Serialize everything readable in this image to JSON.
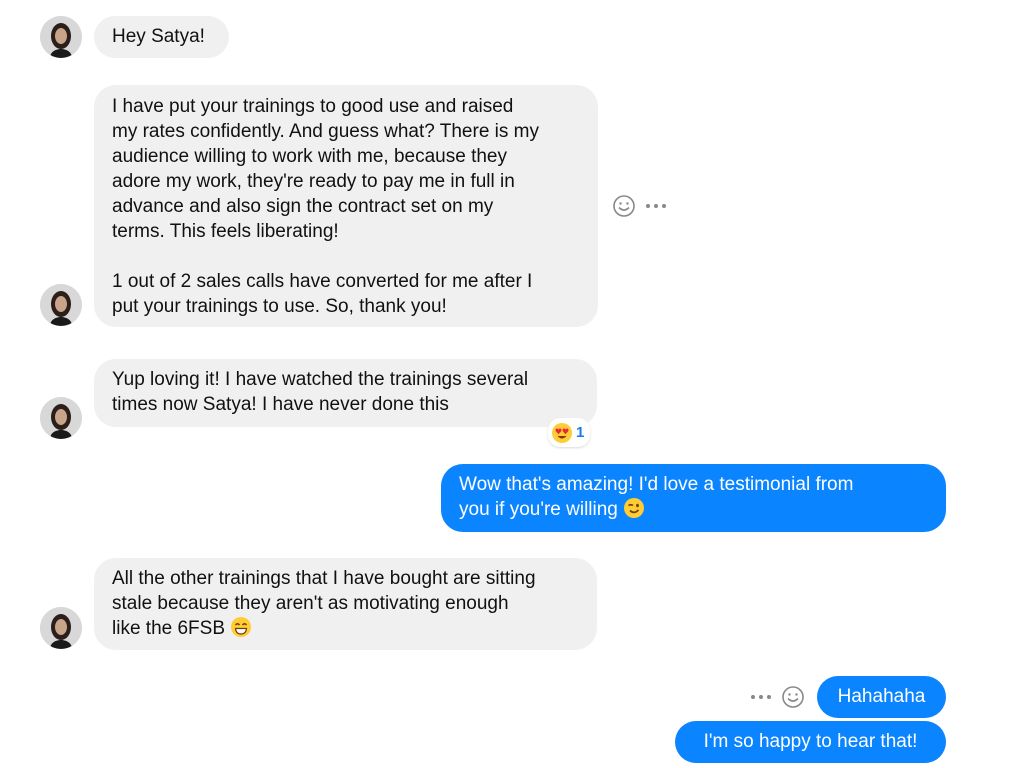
{
  "conversation": {
    "messages": [
      {
        "id": "m1",
        "from": "contact",
        "text": "Hey Satya!"
      },
      {
        "id": "m2",
        "from": "contact",
        "text": "I have put your trainings to good use and raised\nmy rates confidently. And guess what? There is my\naudience willing to work with me, because they\nadore my work, they're ready to pay me in full in\nadvance and also sign the contract set on my\nterms. This feels liberating!\n\n1 out of 2 sales calls have converted for me after I\nput your trainings to use. So, thank you!"
      },
      {
        "id": "m3",
        "from": "contact",
        "text": "Yup loving it! I have watched the trainings several\ntimes now Satya! I have never done this",
        "reaction": {
          "emoji": "heart-eyes-emoji",
          "count": "1"
        }
      },
      {
        "id": "m4",
        "from": "me",
        "text": "Wow that's amazing! I'd love a testimonial from\nyou if you're willing",
        "trailing_emoji": "wink-emoji"
      },
      {
        "id": "m5",
        "from": "contact",
        "text": "All the other trainings that I have bought are sitting\nstale because they aren't as motivating enough\nlike the 6FSB",
        "trailing_emoji": "grin-emoji"
      },
      {
        "id": "m6",
        "from": "me",
        "text": "Hahahaha"
      },
      {
        "id": "m7",
        "from": "me",
        "text": "I'm so happy to hear that!"
      }
    ]
  },
  "theme": {
    "incoming_bubble": "#f0f0f0",
    "outgoing_bubble": "#0a84ff",
    "reaction_count_color": "#1877f2"
  },
  "icons": {
    "react": "smiley-icon",
    "more": "more-options-icon"
  }
}
